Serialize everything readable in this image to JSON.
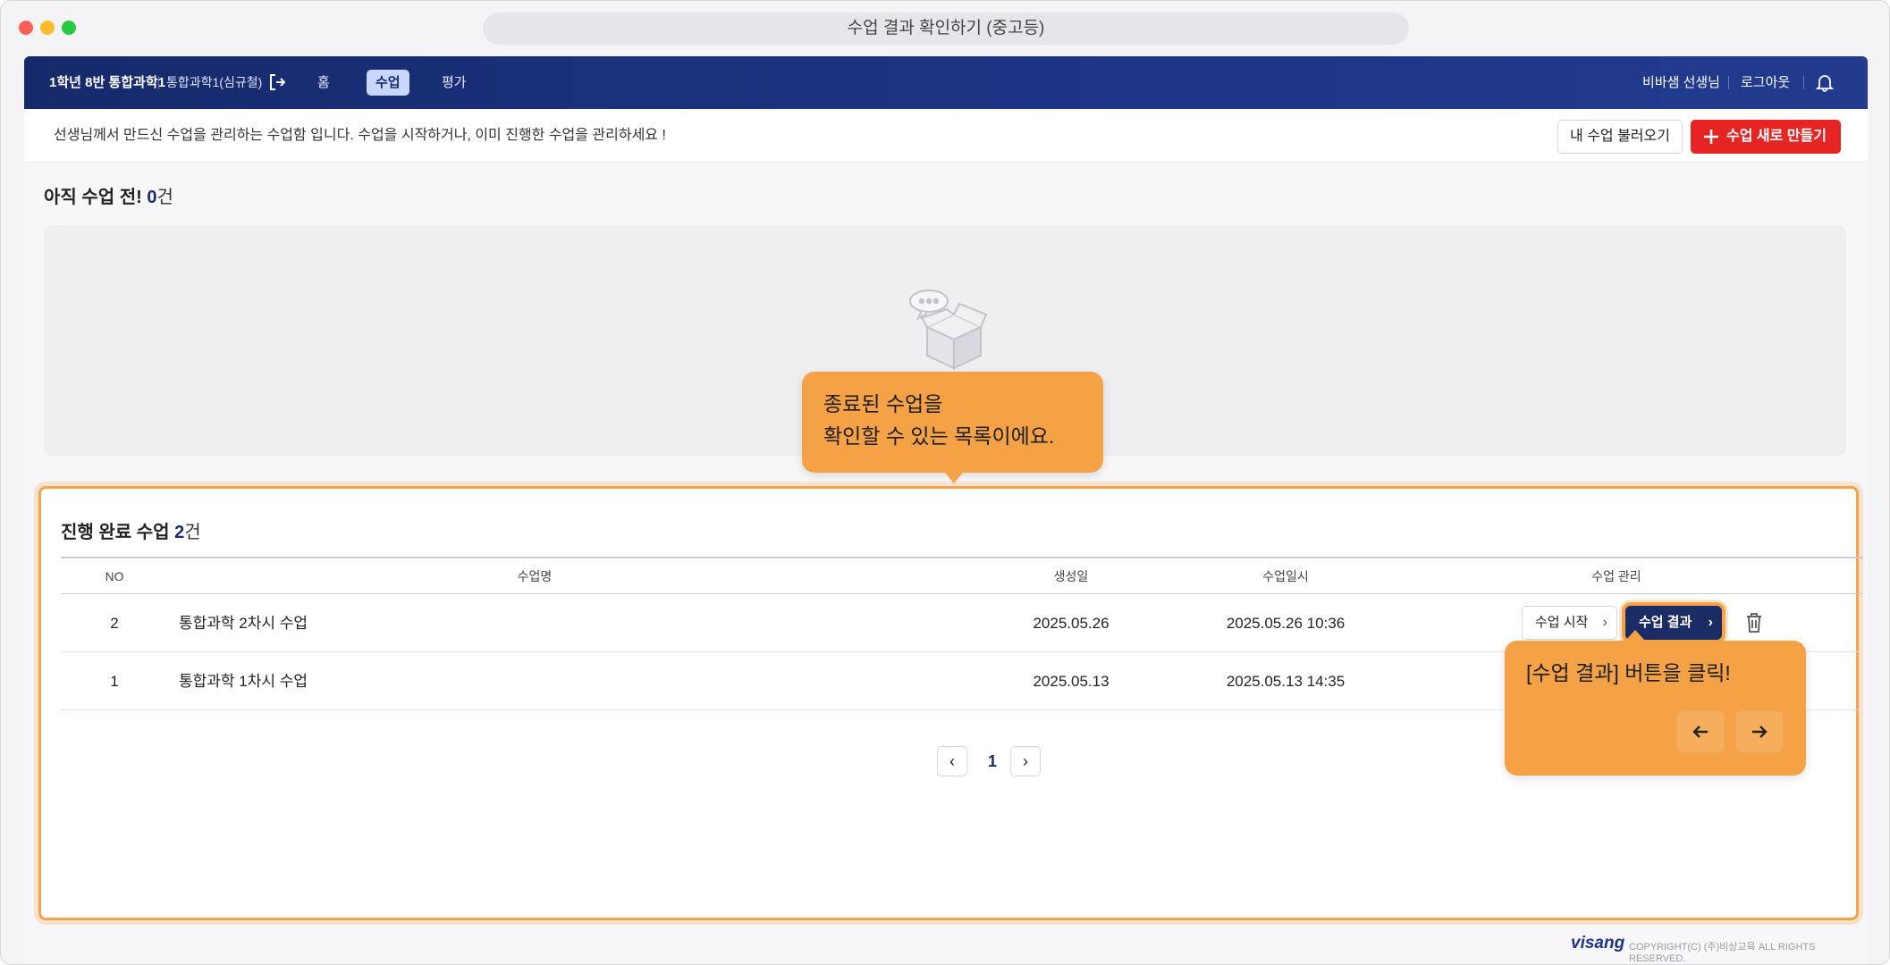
{
  "window": {
    "url_title": "수업 결과 확인하기 (중고등)"
  },
  "topnav": {
    "class_name": "1학년 8반 통합과학1",
    "subject": "통합과학1(심규철)",
    "menu": [
      {
        "label": "홈"
      },
      {
        "label": "수업"
      },
      {
        "label": "평가"
      }
    ],
    "teacher": "비바샘 선생님",
    "logout": "로그아웃"
  },
  "info_bar": {
    "text": "선생님께서 만드신 수업을 관리하는 수업함 입니다. 수업을 시작하거나, 이미 진행한 수업을 관리하세요 !",
    "load_button": "내 수업 불러오기",
    "new_button": "수업 새로 만들기"
  },
  "pending": {
    "title": "아직 수업 전!",
    "count": "0",
    "unit": "건"
  },
  "done": {
    "title": "진행 완료 수업",
    "count": "2",
    "unit": "건",
    "columns": {
      "no": "NO",
      "name": "수업명",
      "created": "생성일",
      "datetime": "수업일시",
      "manage": "수업 관리"
    },
    "rows": [
      {
        "no": "2",
        "name": "통합과학 2차시 수업",
        "created": "2025.05.26",
        "datetime": "2025.05.26 10:36"
      },
      {
        "no": "1",
        "name": "통합과학 1차시 수업",
        "created": "2025.05.13",
        "datetime": "2025.05.13 14:35"
      }
    ],
    "start_button": "수업 시작",
    "result_button": "수업 결과",
    "page": "1"
  },
  "tooltips": {
    "list_tip_line1": "종료된 수업을",
    "list_tip_line2": "확인할 수 있는 목록이에요.",
    "button_tip": "[수업 결과] 버튼을 클릭!"
  },
  "footer": {
    "logo": "visang",
    "copyright": "COPYRIGHT(C) (주)비상교육 ALL RIGHTS RESERVED."
  },
  "colors": {
    "nav": "#1d3586",
    "accent_red": "#e62424",
    "highlight": "#f5a24a",
    "result_button": "#1b2c64"
  }
}
